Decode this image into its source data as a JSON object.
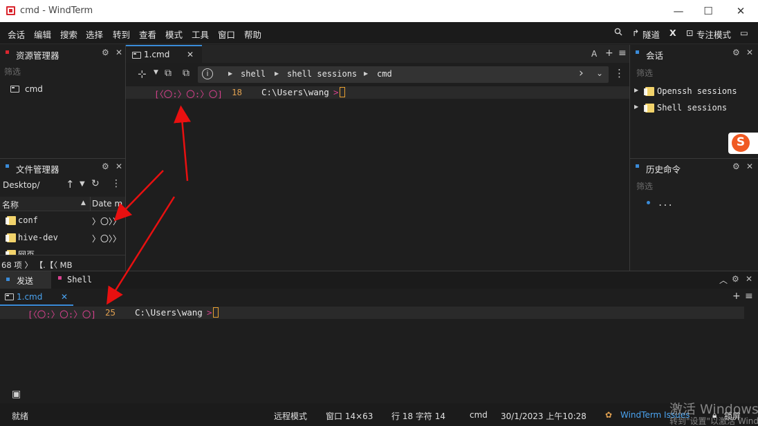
{
  "window": {
    "title": "cmd - WindTerm",
    "minimize": "—",
    "maximize": "☐",
    "close": "✕"
  },
  "menu": [
    "会话",
    "编辑",
    "搜索",
    "选择",
    "转到",
    "查看",
    "模式",
    "工具",
    "窗口",
    "帮助"
  ],
  "menubar_right": {
    "tunnel": "隧道",
    "x_label": "X",
    "focus_mode": "专注模式"
  },
  "resource_manager": {
    "title": "资源管理器",
    "filter_placeholder": "筛选",
    "item": "cmd"
  },
  "file_manager": {
    "title": "文件管理器",
    "path": "Desktop/",
    "columns": [
      "名称",
      "Date m"
    ],
    "files": [
      {
        "name": "conf",
        "date": "〉〇〉〉"
      },
      {
        "name": "hive-dev",
        "date": "〉〇〉〉"
      },
      {
        "name": "网页",
        "date": ""
      }
    ],
    "footer": "68 项 〉 【.【〈 MB"
  },
  "session_panel": {
    "title": "会话",
    "filter_placeholder": "筛选",
    "tree": [
      "Openssh sessions",
      "Shell sessions"
    ]
  },
  "history_panel": {
    "title": "历史命令",
    "filter_placeholder": "筛选",
    "items": [
      "..."
    ]
  },
  "editor": {
    "tab_label": "1.cmd",
    "font_button": "A",
    "breadcrumb": [
      "shell",
      "shell sessions",
      "cmd"
    ],
    "line": {
      "prompt": "[〈〇:〉〇:〉〇]",
      "num": "18",
      "path": "C:\\Users\\wang",
      "gt": ">"
    }
  },
  "send_panel": {
    "tabs": [
      "发送",
      "Shell"
    ],
    "subtab": "1.cmd",
    "line": {
      "prompt": "[〈〇:〉〇:〉〇]",
      "num": "25",
      "path": "C:\\Users\\wang",
      "gt": ">"
    }
  },
  "statusbar": {
    "ready": "就绪",
    "remote_mode": "远程模式",
    "window_size": "窗口 14×63",
    "position": "行 18 字符 14",
    "shell": "cmd",
    "datetime": "30/1/2023 上午10:28",
    "issues_link": "WindTerm Issues",
    "lock": "锁屏"
  },
  "watermark": {
    "line1": "激活 Windows",
    "line2": "转到\"设置\"以激活 Windows。"
  },
  "colors": {
    "accent_blue": "#3a8bd8",
    "magenta": "#d8418e",
    "orange": "#e0a050",
    "arrow_red": "#e81010"
  }
}
